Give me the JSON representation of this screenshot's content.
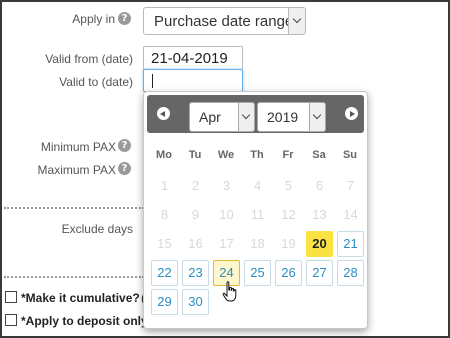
{
  "form": {
    "apply_in_label": "Apply in",
    "apply_in_value": "Purchase date range",
    "valid_from_label": "Valid from (date)",
    "valid_from_value": "21-04-2019",
    "valid_to_label": "Valid to (date)",
    "valid_to_value": "",
    "min_pax_label": "Minimum PAX",
    "max_pax_label": "Maximum PAX",
    "exclude_days_label": "Exclude days",
    "cumulative_label": "*Make it cumulative?",
    "cumulative_after": "(",
    "deposit_label": "*Apply to deposit only",
    "help_glyph": "?"
  },
  "datepicker": {
    "month": "Apr",
    "year": "2019",
    "weekdays": [
      "Mo",
      "Tu",
      "We",
      "Th",
      "Fr",
      "Sa",
      "Su"
    ],
    "weeks": [
      [
        {
          "d": "1",
          "s": "disabled"
        },
        {
          "d": "2",
          "s": "disabled"
        },
        {
          "d": "3",
          "s": "disabled"
        },
        {
          "d": "4",
          "s": "disabled"
        },
        {
          "d": "5",
          "s": "disabled"
        },
        {
          "d": "6",
          "s": "disabled"
        },
        {
          "d": "7",
          "s": "disabled"
        }
      ],
      [
        {
          "d": "8",
          "s": "disabled"
        },
        {
          "d": "9",
          "s": "disabled"
        },
        {
          "d": "10",
          "s": "disabled"
        },
        {
          "d": "11",
          "s": "disabled"
        },
        {
          "d": "12",
          "s": "disabled"
        },
        {
          "d": "13",
          "s": "disabled"
        },
        {
          "d": "14",
          "s": "disabled"
        }
      ],
      [
        {
          "d": "15",
          "s": "disabled"
        },
        {
          "d": "16",
          "s": "disabled"
        },
        {
          "d": "17",
          "s": "disabled"
        },
        {
          "d": "18",
          "s": "disabled"
        },
        {
          "d": "19",
          "s": "disabled"
        },
        {
          "d": "20",
          "s": "today"
        },
        {
          "d": "21",
          "s": "normal"
        }
      ],
      [
        {
          "d": "22",
          "s": "normal"
        },
        {
          "d": "23",
          "s": "normal"
        },
        {
          "d": "24",
          "s": "hover"
        },
        {
          "d": "25",
          "s": "normal"
        },
        {
          "d": "26",
          "s": "normal"
        },
        {
          "d": "27",
          "s": "normal"
        },
        {
          "d": "28",
          "s": "normal"
        }
      ],
      [
        {
          "d": "29",
          "s": "normal"
        },
        {
          "d": "30",
          "s": "normal"
        }
      ]
    ]
  },
  "icons": {
    "prev": "chevron-left-icon",
    "next": "chevron-right-icon",
    "dropdown": "chevron-down-icon",
    "help": "help-icon",
    "cursor": "hand-pointer-icon"
  },
  "colors": {
    "accent_blue": "#2b8fc3",
    "today_yellow": "#f9e241",
    "header_gray": "#666666",
    "focus_blue": "#66afe9"
  }
}
